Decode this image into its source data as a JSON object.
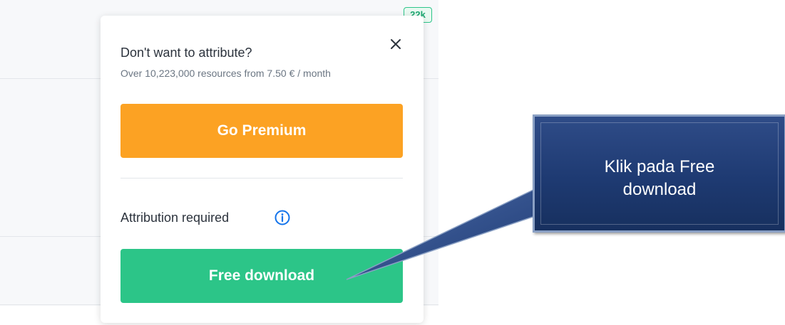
{
  "background": {
    "badge_text": "22k"
  },
  "popup": {
    "title": "Don't want to attribute?",
    "subtitle": "Over 10,223,000 resources from 7.50 € / month",
    "close_icon": "close-icon",
    "premium_button_label": "Go Premium",
    "attribution_label": "Attribution required",
    "info_icon": "info-icon",
    "free_download_label": "Free download"
  },
  "callout": {
    "line1": "Klik pada Free",
    "line2": "download"
  },
  "colors": {
    "premium": "#fca223",
    "free_download": "#2cc588",
    "info": "#1273eb",
    "callout": "#1e3a72"
  }
}
